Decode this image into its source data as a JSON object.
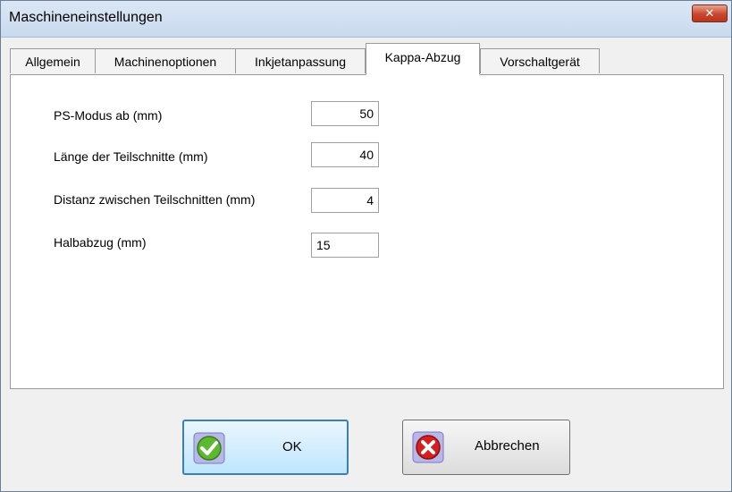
{
  "window": {
    "title": "Maschineneinstellungen",
    "close_label": "✕"
  },
  "tabs": [
    {
      "label": "Allgemein"
    },
    {
      "label": "Machinenoptionen"
    },
    {
      "label": "Inkjetanpassung"
    },
    {
      "label": "Kappa-Abzug",
      "active": true
    },
    {
      "label": "Vorschaltgerät"
    }
  ],
  "fields": {
    "ps_modus": {
      "label": "PS-Modus ab (mm)",
      "value": "50"
    },
    "laenge": {
      "label": "Länge der Teilschnitte (mm)",
      "value": "40"
    },
    "distanz": {
      "label": "Distanz zwischen Teilschnitten (mm)",
      "value": "4"
    },
    "halbabzug": {
      "label": "Halbabzug (mm)",
      "value": "15"
    }
  },
  "buttons": {
    "ok": {
      "label": "OK",
      "icon": "checkmark-icon",
      "color": "#5cb82e"
    },
    "cancel": {
      "label": "Abbrechen",
      "icon": "cancel-x-icon",
      "color": "#d81e1e"
    }
  }
}
